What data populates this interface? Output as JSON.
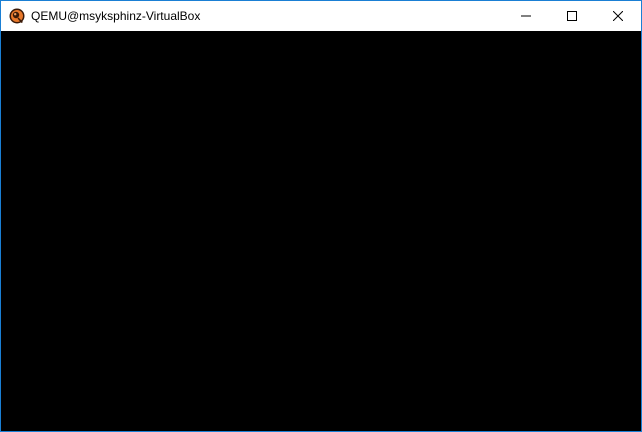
{
  "window": {
    "title": "QEMU@msyksphinz-VirtualBox",
    "app_icon": "qemu-icon",
    "border_color": "#1a7fd4"
  },
  "controls": [
    {
      "name": "minimize",
      "icon": "minimize-icon"
    },
    {
      "name": "maximize",
      "icon": "maximize-icon"
    },
    {
      "name": "close",
      "icon": "close-icon"
    }
  ],
  "screen": {
    "background": "#000000"
  }
}
